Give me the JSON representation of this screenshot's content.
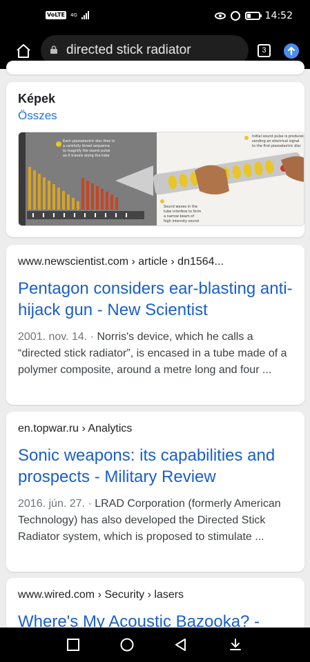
{
  "status_bar": {
    "volte": "VoLTE",
    "network": "4G",
    "time": "14:52"
  },
  "browser": {
    "url_text": "directed stick radiator",
    "tab_count": "3"
  },
  "images_section": {
    "title": "Képek",
    "all_link": "Összes"
  },
  "results": [
    {
      "breadcrumb": "www.newscientist.com › article › dn1564...",
      "title": "Pentagon considers ear-blasting anti-hijack gun - New Scientist",
      "date": "2001. nov. 14.",
      "separator": " · ",
      "snippet": "Norris's device, which he calls a “directed stick radiator”, is encased in a tube made of a polymer composite, around a metre long and four ..."
    },
    {
      "breadcrumb": "en.topwar.ru › Analytics",
      "title": "Sonic weapons: its capabilities and prospects - Military Review",
      "date": "2016. jún. 27.",
      "separator": " · ",
      "snippet": "LRAD Corporation (formerly American Technology) has also developed the Directed Stick Radiator system, which is proposed to stimulate ..."
    },
    {
      "breadcrumb": "www.wired.com › Security › lasers",
      "title": "Where's My Acoustic Bazooka? -"
    }
  ],
  "colors": {
    "link": "#1a5fc7",
    "accent": "#1a73e8",
    "bar": "#000000"
  }
}
